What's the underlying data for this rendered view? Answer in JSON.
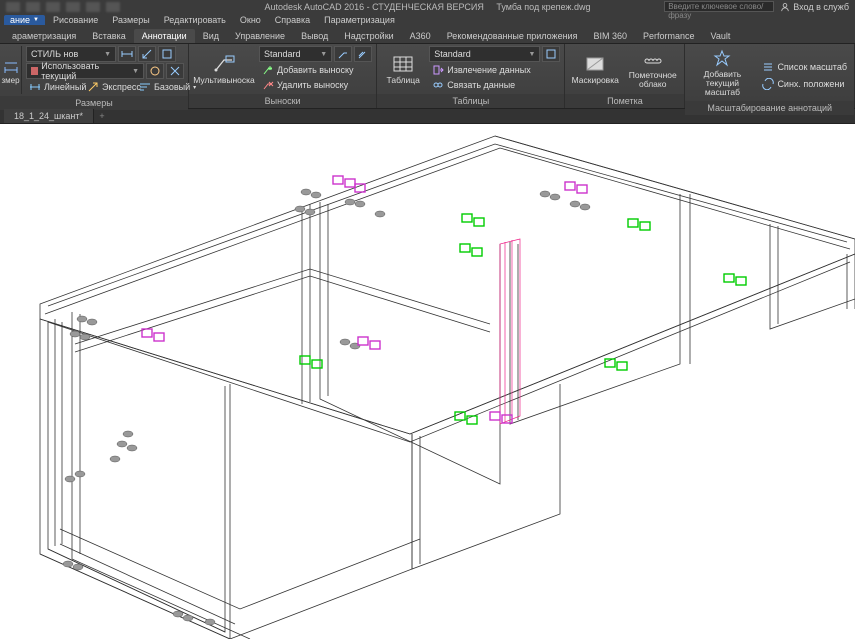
{
  "title": {
    "app": "Autodesk AutoCAD 2016 - СТУДЕНЧЕСКАЯ ВЕРСИЯ",
    "file": "Тумба под крепеж.dwg",
    "search_placeholder": "Введите ключевое слово/фразу",
    "login": "Вход в служб"
  },
  "menu": {
    "btn": "ание",
    "items": [
      "Рисование",
      "Размеры",
      "Редактировать",
      "Окно",
      "Справка",
      "Параметризация"
    ]
  },
  "tabs": {
    "items": [
      "араметризация",
      "Вставка",
      "Аннотации",
      "Вид",
      "Управление",
      "Вывод",
      "Надстройки",
      "A360",
      "Рекомендованные приложения",
      "BIM 360",
      "Performance",
      "Vault"
    ],
    "active": 2
  },
  "ribbon": {
    "panels": {
      "dims": {
        "title": "Размеры",
        "left_label": "змер",
        "style": "СТИЛЬ нов",
        "use_current": "Использовать текущий",
        "btn1": "Линейный",
        "btn2": "Экспресс",
        "btn3": "Базовый"
      },
      "leaders": {
        "title": "Выноски",
        "big": "Мультивыноска",
        "style": "Standard",
        "add": "Добавить выноску",
        "del": "Удалить выноску"
      },
      "tables": {
        "title": "Таблицы",
        "big": "Таблица",
        "style": "Standard",
        "extract": "Извлечение данных",
        "link": "Связать данные"
      },
      "mark": {
        "title": "Пометка",
        "b1": "Маскировка",
        "b2": "Пометочное облако"
      },
      "scale": {
        "title": "Масштабирование аннотаций",
        "b1": "Добавить текущий масштаб",
        "r1": "Список масштаб",
        "r2": "Синх. положени"
      }
    }
  },
  "filetabs": {
    "items": [
      "18_1_24_шкант*"
    ]
  }
}
